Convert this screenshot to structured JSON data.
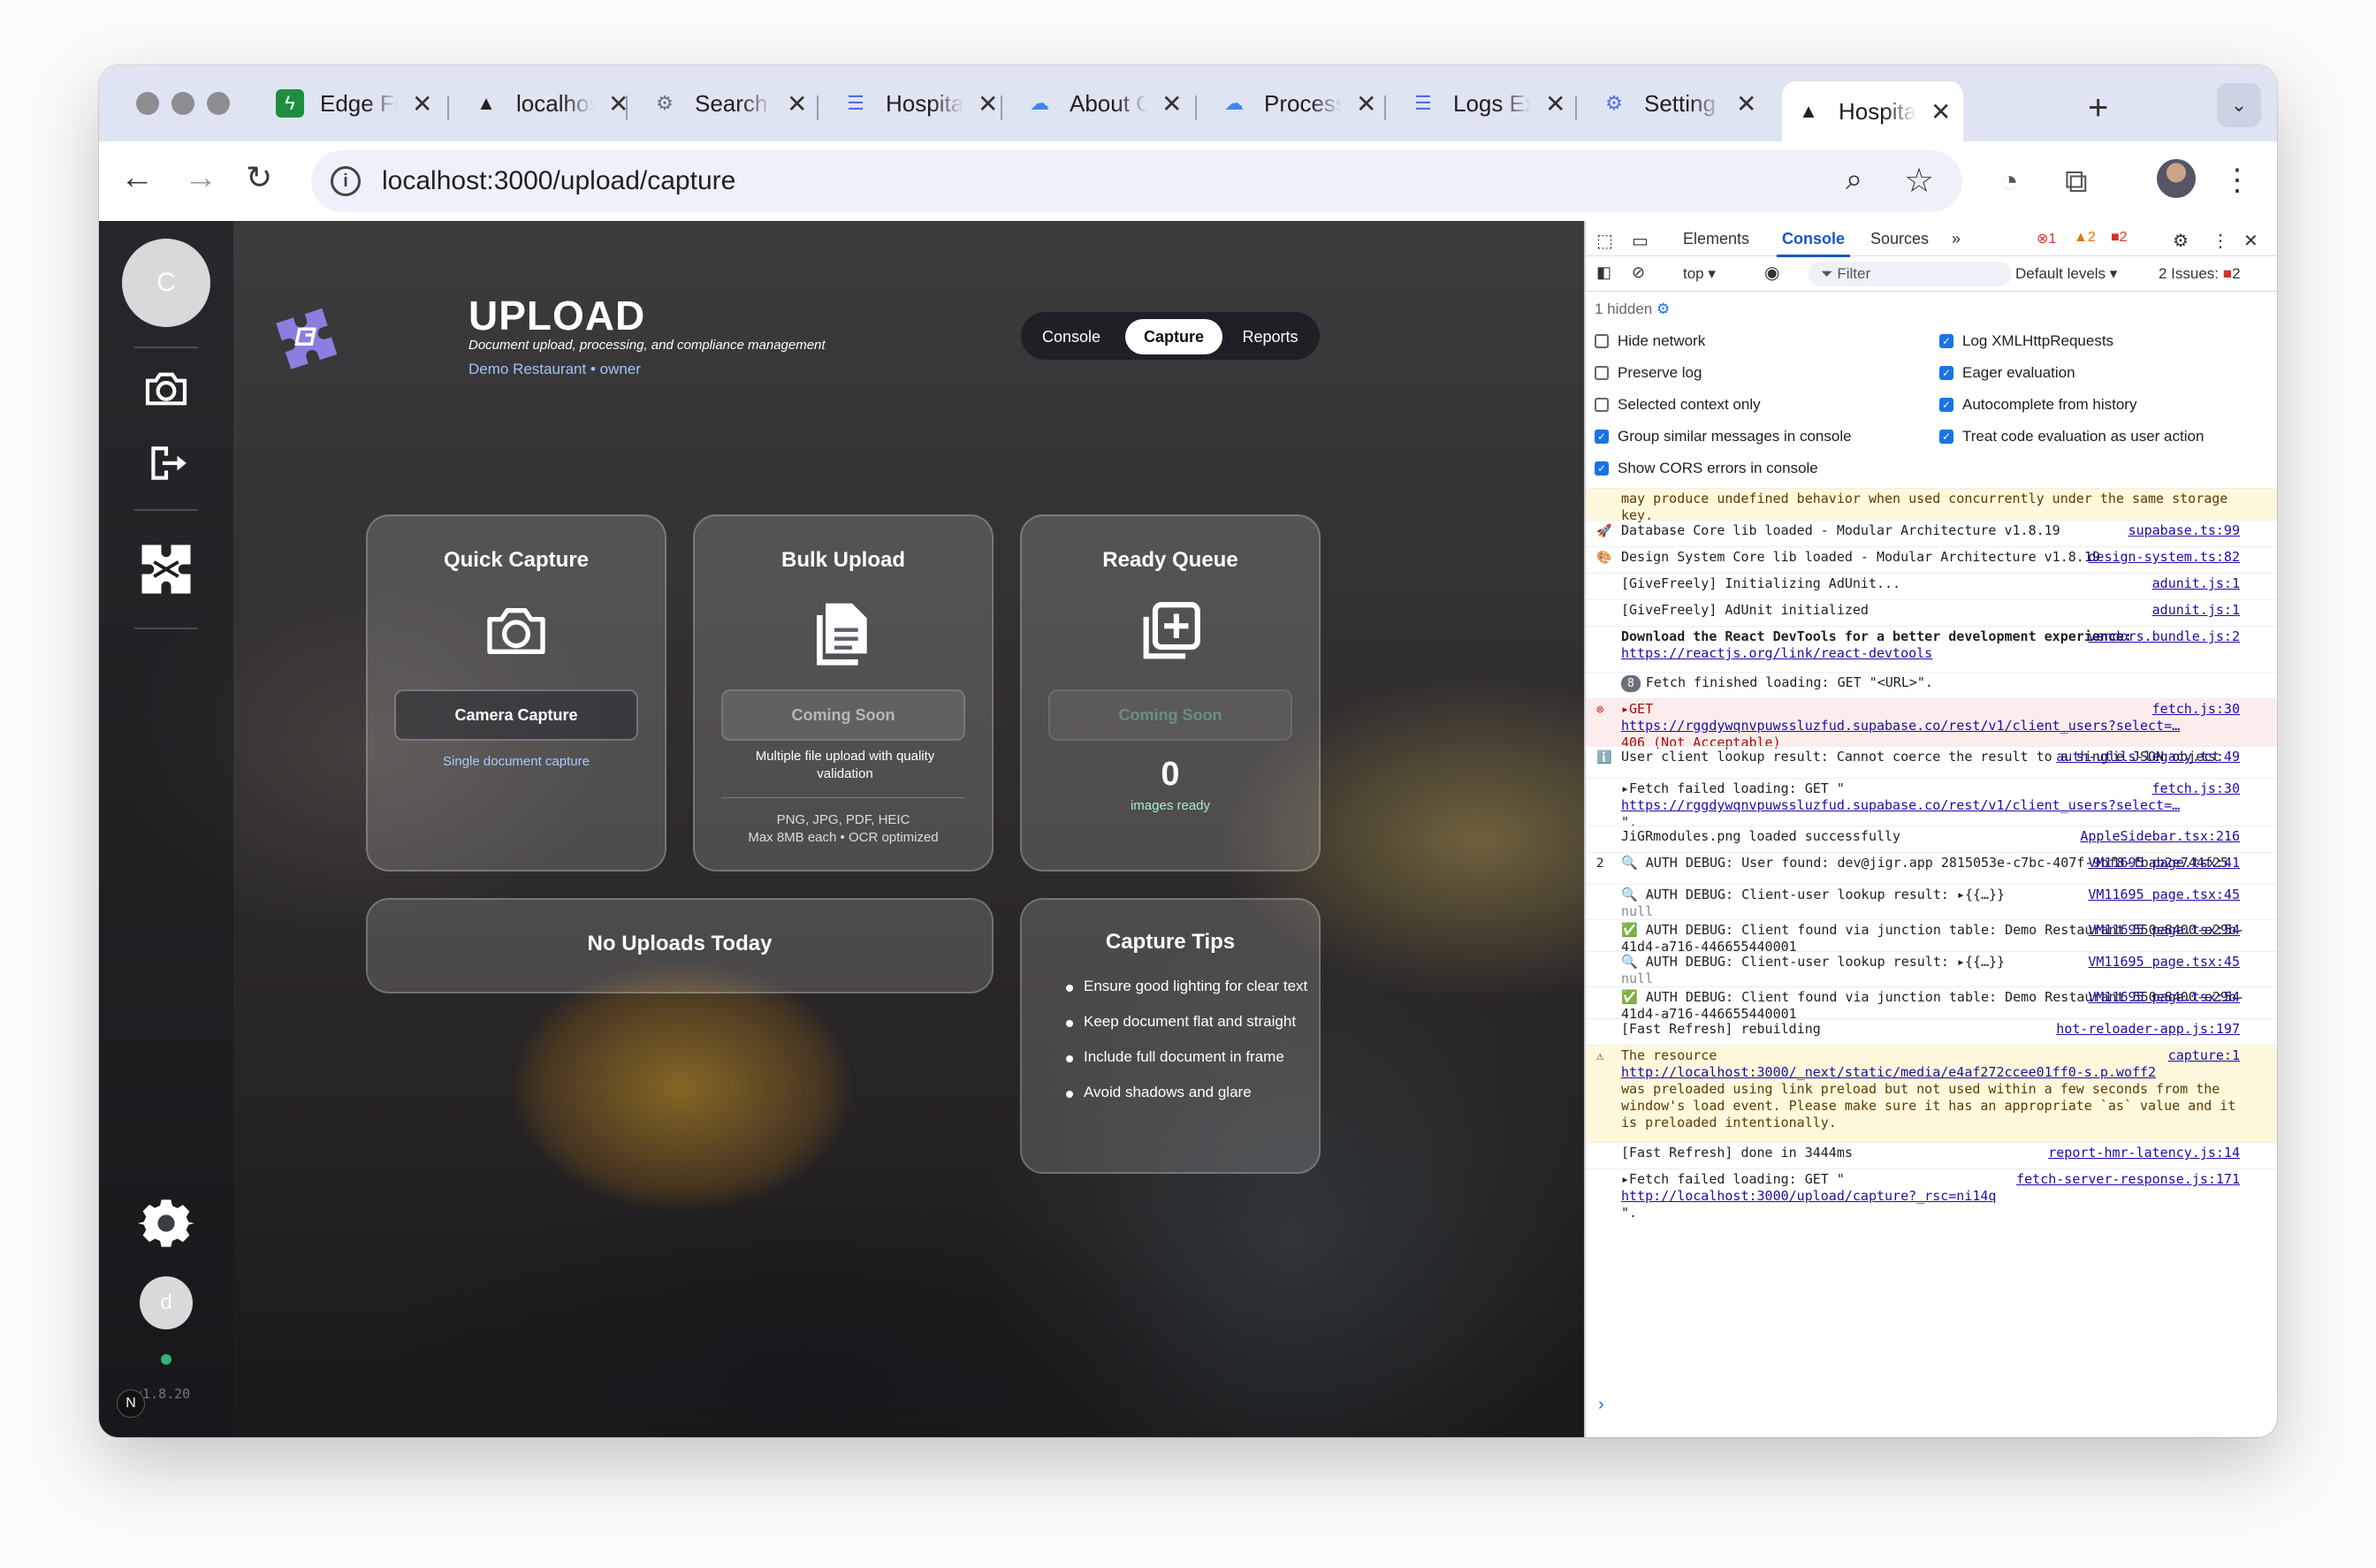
{
  "browser": {
    "tabs": [
      {
        "title": "Edge Fu",
        "favicon": "bolt",
        "color": "#1e8e3e"
      },
      {
        "title": "localhost",
        "favicon": "triangle",
        "color": "#222222"
      },
      {
        "title": "Search",
        "favicon": "gear",
        "color": "#6b6f78"
      },
      {
        "title": "Hospita",
        "favicon": "list",
        "color": "#4b6cf0"
      },
      {
        "title": "About C",
        "favicon": "cloud",
        "color": "#4285f4"
      },
      {
        "title": "Process",
        "favicon": "cloud",
        "color": "#4285f4"
      },
      {
        "title": "Logs Ex",
        "favicon": "list",
        "color": "#4b6cf0"
      },
      {
        "title": "Setting",
        "favicon": "gear",
        "color": "#4b6cf0"
      },
      {
        "title": "Hospita",
        "favicon": "triangle",
        "color": "#222222",
        "active": true
      }
    ],
    "new_tab": "+",
    "url": "localhost:3000/upload/capture"
  },
  "sidebar": {
    "avatar_initial": "C",
    "user_initial": "d",
    "version": "v1.8.20",
    "next_badge": "N"
  },
  "header": {
    "title": "UPLOAD",
    "subtitle": "Document upload, processing, and compliance management",
    "org": "Demo Restaurant • owner"
  },
  "segment": {
    "items": [
      "Console",
      "Capture",
      "Reports"
    ],
    "selected": "Capture"
  },
  "cards": {
    "quick": {
      "title": "Quick Capture",
      "button": "Camera Capture",
      "note": "Single document capture"
    },
    "bulk": {
      "title": "Bulk Upload",
      "button": "Coming Soon",
      "note": "Multiple file upload with quality validation",
      "formats": "PNG, JPG, PDF, HEIC",
      "limits": "Max 8MB each • OCR optimized"
    },
    "queue": {
      "title": "Ready Queue",
      "button": "Coming Soon",
      "count": "0",
      "count_label": "images ready"
    },
    "uploads": {
      "title": "No Uploads Today"
    },
    "tips": {
      "title": "Capture Tips",
      "items": [
        "Ensure good lighting for clear text",
        "Keep document flat and straight",
        "Include full document in frame",
        "Avoid shadows and glare"
      ]
    }
  },
  "devtools": {
    "tabs": [
      "Elements",
      "Console",
      "Sources"
    ],
    "active_tab": "Console",
    "errors": "1",
    "warnings": "2",
    "issues_count": "2",
    "context": "top",
    "filter_placeholder": "Filter",
    "levels": "Default levels",
    "issues": "2 Issues:",
    "hidden": "1 hidden",
    "settings_left": [
      {
        "label": "Hide network",
        "checked": false
      },
      {
        "label": "Preserve log",
        "checked": false
      },
      {
        "label": "Selected context only",
        "checked": false
      },
      {
        "label": "Group similar messages in console",
        "checked": true
      },
      {
        "label": "Show CORS errors in console",
        "checked": true
      }
    ],
    "settings_right": [
      {
        "label": "Log XMLHttpRequests",
        "checked": true
      },
      {
        "label": "Eager evaluation",
        "checked": true
      },
      {
        "label": "Autocomplete from history",
        "checked": true
      },
      {
        "label": "Treat code evaluation as user action",
        "checked": true
      }
    ],
    "logs": [
      {
        "type": "warn",
        "text": "may produce undefined behavior when used concurrently under the same storage key.",
        "src": ""
      },
      {
        "type": "info",
        "lead": "🚀",
        "text": "Database Core lib loaded - Modular Architecture v1.8.19",
        "src": "supabase.ts:99"
      },
      {
        "type": "info",
        "lead": "🎨",
        "text": "Design System Core lib loaded - Modular Architecture v1.8.19",
        "src": "design-system.ts:82"
      },
      {
        "type": "info",
        "text": "[GiveFreely] Initializing AdUnit...",
        "src": "adunit.js:1"
      },
      {
        "type": "info",
        "text": "[GiveFreely] AdUnit initialized",
        "src": "adunit.js:1"
      },
      {
        "type": "info",
        "text": "Download the React DevTools for a better development experience:",
        "link": "https://reactjs.org/link/react-devtools",
        "src": "vendors.bundle.js:2"
      },
      {
        "type": "info",
        "badge": "8",
        "text": "Fetch finished loading: GET \"<URL>\".",
        "src": ""
      },
      {
        "type": "err",
        "text": "▸GET",
        "link": "https://rggdywqnvpuwssluzfud.supabase.co/rest/v1/client_users?select=…",
        "extra": "406 (Not Acceptable)",
        "src": "fetch.js:30"
      },
      {
        "type": "info",
        "lead": "ℹ️",
        "text": "User client lookup result: Cannot coerce the result to a single JSON object",
        "src": "auth-utils-legacy.ts:49"
      },
      {
        "type": "info",
        "text": "▸Fetch failed loading: GET \"",
        "link": "https://rggdywqnvpuwssluzfud.supabase.co/rest/v1/client_users?select=…",
        "extra": "\".",
        "src": "fetch.js:30"
      },
      {
        "type": "info",
        "text": "JiGRmodules.png loaded successfully",
        "src": "AppleSidebar.tsx:216"
      },
      {
        "type": "info",
        "lead": "2",
        "text": "🔍 AUTH DEBUG: User found: dev@jigr.app 2815053e-c7bc-407f-9bf8-fbab2e744f25",
        "src": "VM11695 page.tsx:41"
      },
      {
        "type": "info",
        "text": "🔍 AUTH DEBUG: Client-user lookup result: ▸{{…}}",
        "extra": "null",
        "src": "VM11695 page.tsx:45"
      },
      {
        "type": "info",
        "text": "✅ AUTH DEBUG: Client found via junction table: Demo Restaurant 550e8400-e29b-41d4-a716-446655440001",
        "src": "VM11695 page.tsx:54"
      },
      {
        "type": "info",
        "text": "🔍 AUTH DEBUG: Client-user lookup result: ▸{{…}}",
        "extra": "null",
        "src": "VM11695 page.tsx:45"
      },
      {
        "type": "info",
        "text": "✅ AUTH DEBUG: Client found via junction table: Demo Restaurant 550e8400-e29b-41d4-a716-446655440001",
        "src": "VM11695 page.tsx:54"
      },
      {
        "type": "info",
        "text": "[Fast Refresh] rebuilding",
        "src": "hot-reloader-app.js:197"
      },
      {
        "type": "warn",
        "lead": "⚠",
        "text": "The resource",
        "link": "http://localhost:3000/_next/static/media/e4af272ccee01ff0-s.p.woff2",
        "extra": "was preloaded using link preload but not used within a few seconds from the window's load event. Please make sure it has an appropriate `as` value and it is preloaded intentionally.",
        "src": "capture:1"
      },
      {
        "type": "info",
        "text": "[Fast Refresh] done in 3444ms",
        "src": "report-hmr-latency.js:14"
      },
      {
        "type": "info",
        "text": "▸Fetch failed loading: GET \"",
        "link": "http://localhost:3000/upload/capture?_rsc=ni14q",
        "extra": "\".",
        "src": "fetch-server-response.js:171"
      }
    ],
    "prompt": "›"
  }
}
